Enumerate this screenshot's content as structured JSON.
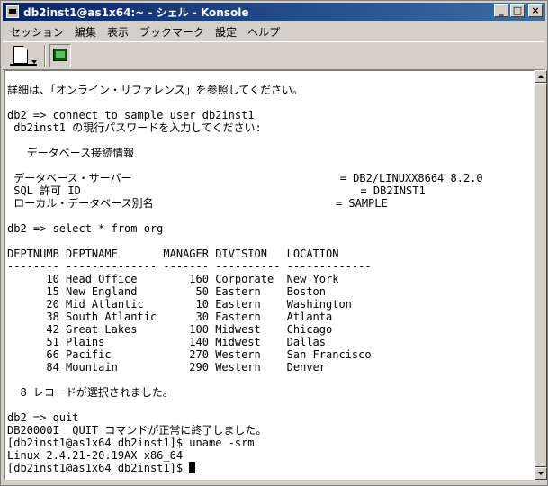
{
  "window": {
    "title": "db2inst1@as1x64:~ - シェル - Konsole",
    "minimize_glyph": "_",
    "maximize_glyph": "□",
    "close_glyph": "×"
  },
  "menu": {
    "items": [
      {
        "label": "セッション"
      },
      {
        "label": "編集"
      },
      {
        "label": "表示"
      },
      {
        "label": "ブックマーク"
      },
      {
        "label": "設定"
      },
      {
        "label": "ヘルプ"
      }
    ]
  },
  "toolbar": {
    "new_session_icon": "new-session-icon",
    "terminal_icon": "terminal-icon"
  },
  "terminal": {
    "lines": [
      "詳細は、「オンライン・リファレンス」を参照してください。",
      "",
      "db2 => connect to sample user db2inst1",
      " db2inst1 の現行パスワードを入力してください:",
      "",
      "   データベース接続情報",
      "",
      " データベース・サーバー                                = DB2/LINUXX8664 8.2.0",
      " SQL 許可 ID                                           = DB2INST1",
      " ローカル・データベース別名                            = SAMPLE",
      "",
      "db2 => select * from org",
      "",
      "DEPTNUMB DEPTNAME       MANAGER DIVISION   LOCATION",
      "-------- -------------- ------- ---------- -------------",
      "      10 Head Office        160 Corporate  New York",
      "      15 New England         50 Eastern    Boston",
      "      20 Mid Atlantic        10 Eastern    Washington",
      "      38 South Atlantic      30 Eastern    Atlanta",
      "      42 Great Lakes        100 Midwest    Chicago",
      "      51 Plains             140 Midwest    Dallas",
      "      66 Pacific            270 Western    San Francisco",
      "      84 Mountain           290 Western    Denver",
      "",
      "  8 レコードが選択されました。",
      "",
      "db2 => quit",
      "DB20000I  QUIT コマンドが正常に終了しました。",
      "[db2inst1@as1x64 db2inst1]$ uname -srm",
      "Linux 2.4.21-20.19AX x86_64"
    ],
    "prompt": "[db2inst1@as1x64 db2inst1]$ "
  }
}
